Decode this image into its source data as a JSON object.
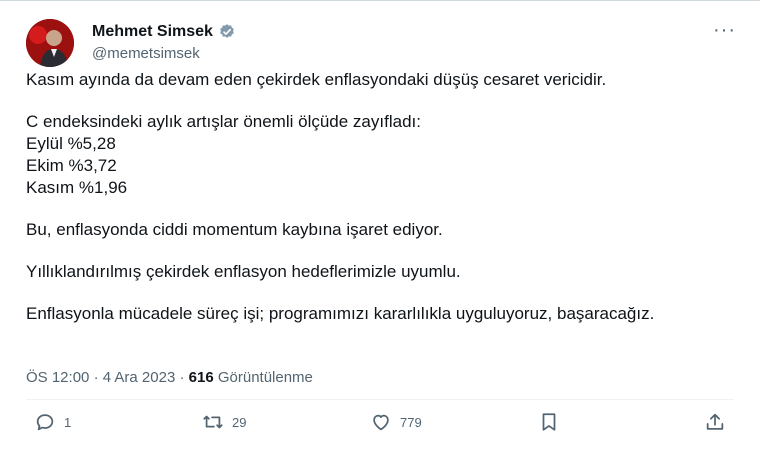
{
  "author": {
    "name": "Mehmet Simsek",
    "handle": "@memetsimsek"
  },
  "more_label": "···",
  "tweet": {
    "p1": "Kasım ayında da devam eden çekirdek enflasyondaki düşüş cesaret vericidir.",
    "p2_intro": "C endeksindeki aylık artışlar önemli ölçüde zayıfladı:",
    "p2_lines": [
      "Eylül %5,28",
      "Ekim %3,72",
      "Kasım %1,96"
    ],
    "p3": "Bu, enflasyonda ciddi momentum kaybına işaret ediyor.",
    "p4": "Yıllıklandırılmış çekirdek enflasyon hedeflerimizle uyumlu.",
    "p5": "Enflasyonla mücadele süreç işi; programımızı kararlılıkla uyguluyoruz, başaracağız."
  },
  "meta": {
    "time": "ÖS 12:00",
    "sep": "·",
    "date": "4 Ara 2023",
    "views_count": "616",
    "views_label": "Görüntülenme"
  },
  "actions": {
    "replies": "1",
    "retweets": "29",
    "likes": "779"
  },
  "colors": {
    "verified": "#829aab",
    "muted": "#536471",
    "avatar_bg": "#8a0f0f"
  },
  "icons": [
    "reply-icon",
    "retweet-icon",
    "heart-icon",
    "bookmark-icon",
    "share-icon",
    "verified-icon"
  ]
}
